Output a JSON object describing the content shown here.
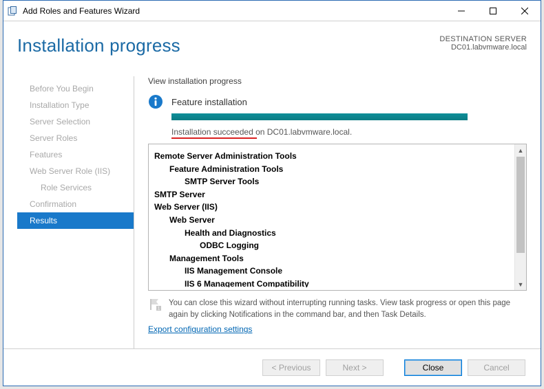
{
  "window": {
    "title": "Add Roles and Features Wizard"
  },
  "header": {
    "heading": "Installation progress",
    "dest_label": "DESTINATION SERVER",
    "dest_server": "DC01.labvmware.local"
  },
  "sidebar": {
    "steps": [
      {
        "label": "Before You Begin"
      },
      {
        "label": "Installation Type"
      },
      {
        "label": "Server Selection"
      },
      {
        "label": "Server Roles"
      },
      {
        "label": "Features"
      },
      {
        "label": "Web Server Role (IIS)"
      },
      {
        "label": "Role Services",
        "child": true
      },
      {
        "label": "Confirmation"
      },
      {
        "label": "Results",
        "selected": true
      }
    ]
  },
  "main": {
    "subhead": "View installation progress",
    "status_label": "Feature installation",
    "status_msg_prefix": "Installation succeeded",
    "status_msg_suffix": " on DC01.labvmware.local.",
    "features": [
      {
        "text": "Remote Server Administration Tools",
        "level": 1,
        "bold": true
      },
      {
        "text": "Feature Administration Tools",
        "level": 2,
        "bold": true
      },
      {
        "text": "SMTP Server Tools",
        "level": 3,
        "bold": true
      },
      {
        "text": "SMTP Server",
        "level": 1,
        "bold": true
      },
      {
        "text": "Web Server (IIS)",
        "level": 1,
        "bold": true
      },
      {
        "text": "Web Server",
        "level": 2,
        "bold": true
      },
      {
        "text": "Health and Diagnostics",
        "level": 3,
        "bold": true
      },
      {
        "text": "ODBC Logging",
        "level": 4,
        "bold": true
      },
      {
        "text": "Management Tools",
        "level": 2,
        "bold": true
      },
      {
        "text": "IIS Management Console",
        "level": 3,
        "bold": true
      },
      {
        "text": "IIS 6 Management Compatibility",
        "level": 3,
        "bold": true
      }
    ],
    "note": "You can close this wizard without interrupting running tasks. View task progress or open this page again by clicking Notifications in the command bar, and then Task Details.",
    "export_link": "Export configuration settings"
  },
  "footer": {
    "previous": "< Previous",
    "next": "Next >",
    "close": "Close",
    "cancel": "Cancel"
  }
}
